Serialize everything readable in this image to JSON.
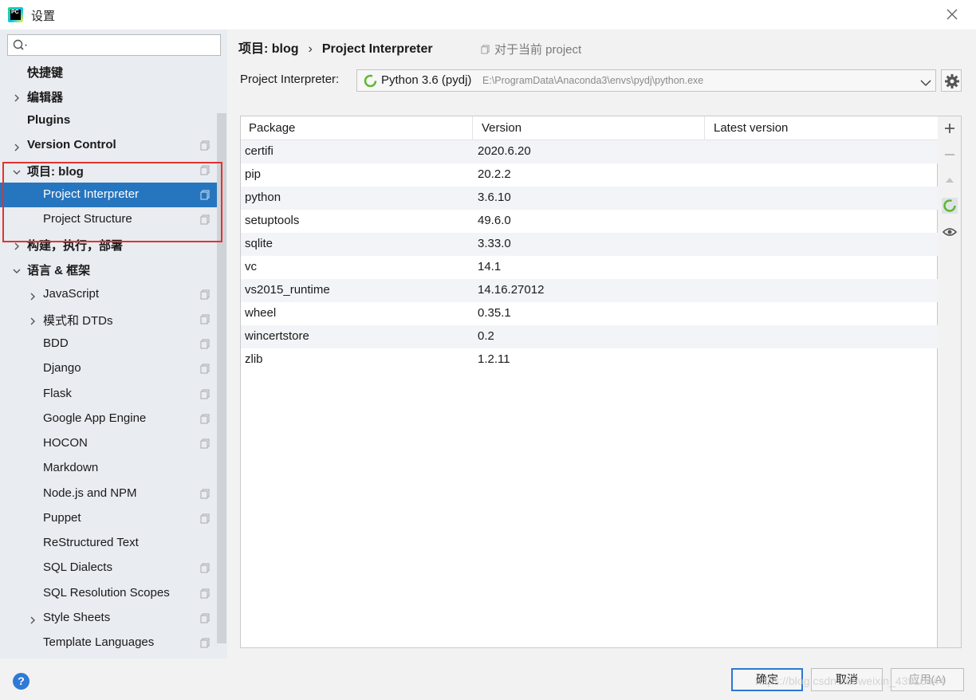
{
  "window": {
    "title": "设置"
  },
  "search": {
    "placeholder": ""
  },
  "tree": {
    "items": [
      {
        "label": "快捷键"
      },
      {
        "label": "编辑器"
      },
      {
        "label": "Plugins"
      },
      {
        "label": "Version Control"
      },
      {
        "label": "项目: blog"
      },
      {
        "label": "Project Interpreter"
      },
      {
        "label": "Project Structure"
      },
      {
        "label": "构建，执行，部署"
      },
      {
        "label": "语言 & 框架"
      },
      {
        "label": "JavaScript"
      },
      {
        "label": "模式和 DTDs"
      },
      {
        "label": "BDD"
      },
      {
        "label": "Django"
      },
      {
        "label": "Flask"
      },
      {
        "label": "Google App Engine"
      },
      {
        "label": "HOCON"
      },
      {
        "label": "Markdown"
      },
      {
        "label": "Node.js and NPM"
      },
      {
        "label": "Puppet"
      },
      {
        "label": "ReStructured Text"
      },
      {
        "label": "SQL Dialects"
      },
      {
        "label": "SQL Resolution Scopes"
      },
      {
        "label": "Style Sheets"
      },
      {
        "label": "Template Languages"
      }
    ]
  },
  "breadcrumb": {
    "project": "项目: blog",
    "separator": "›",
    "page": "Project Interpreter"
  },
  "for_current_project": "对于当前 project",
  "interpreter": {
    "label": "Project Interpreter:",
    "name": "Python 3.6 (pydj)",
    "path": "E:\\ProgramData\\Anaconda3\\envs\\pydj\\python.exe"
  },
  "packages": {
    "columns": [
      "Package",
      "Version",
      "Latest version"
    ],
    "rows": [
      {
        "package": "certifi",
        "version": "2020.6.20",
        "latest": ""
      },
      {
        "package": "pip",
        "version": "20.2.2",
        "latest": ""
      },
      {
        "package": "python",
        "version": "3.6.10",
        "latest": ""
      },
      {
        "package": "setuptools",
        "version": "49.6.0",
        "latest": ""
      },
      {
        "package": "sqlite",
        "version": "3.33.0",
        "latest": ""
      },
      {
        "package": "vc",
        "version": "14.1",
        "latest": ""
      },
      {
        "package": "vs2015_runtime",
        "version": "14.16.27012",
        "latest": ""
      },
      {
        "package": "wheel",
        "version": "0.35.1",
        "latest": ""
      },
      {
        "package": "wincertstore",
        "version": "0.2",
        "latest": ""
      },
      {
        "package": "zlib",
        "version": "1.2.11",
        "latest": ""
      }
    ]
  },
  "buttons": {
    "ok": "确定",
    "cancel": "取消",
    "apply": "应用(A)",
    "help": "?"
  },
  "watermark": "https://blog.csdn.net/weixin_43910444",
  "colors": {
    "selection": "#2675bf",
    "highlight_box": "#e3322f",
    "accent": "#2d78d4"
  }
}
